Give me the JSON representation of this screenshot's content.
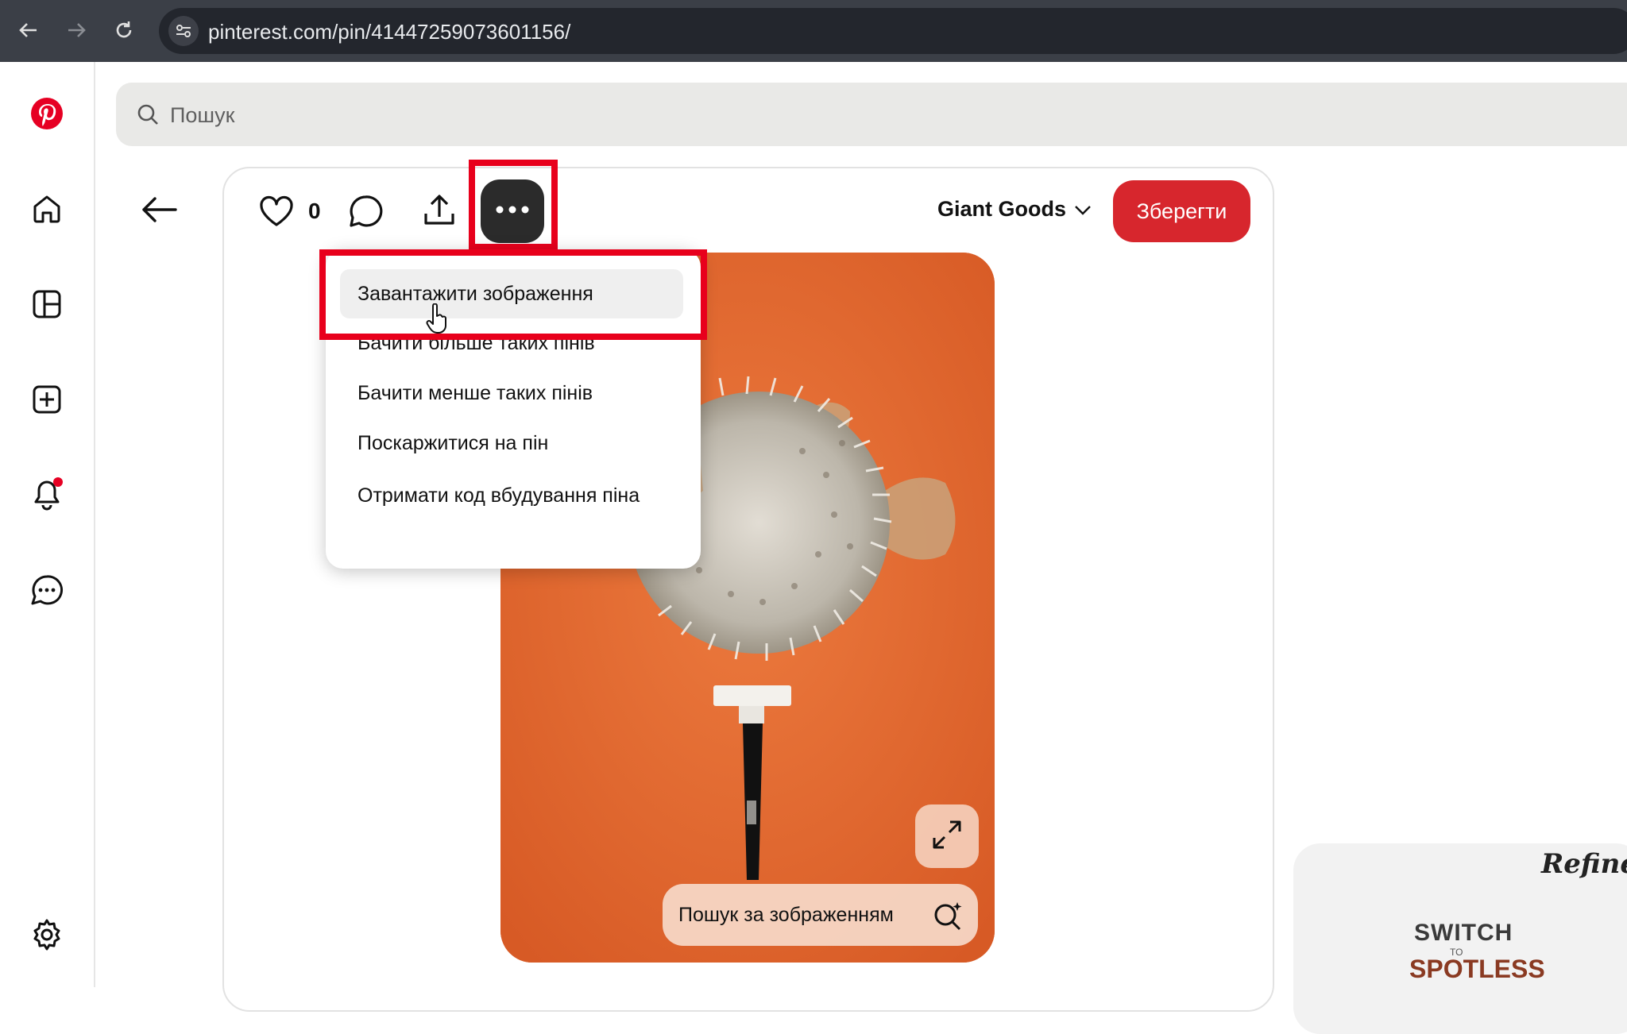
{
  "browser": {
    "url": "pinterest.com/pin/414472590736011​56/"
  },
  "search": {
    "placeholder": "Пошук"
  },
  "pin": {
    "like_count": "0",
    "board_name": "Giant Goods",
    "save_label": "Зберегти",
    "visual_search_label": "Пошук за зображенням"
  },
  "menu": {
    "items": [
      "Завантажити зображення",
      "Бачити більше таких пінів",
      "Бачити менше таких пінів",
      "Поскаржитися на пін",
      "Отримати код вбудування піна"
    ]
  },
  "ad": {
    "brand": "Refine",
    "line1": "SWITCH",
    "line2": "TO",
    "line3": "SPOTLESS"
  },
  "colors": {
    "brand_red": "#e60023",
    "save_button": "#d7262d",
    "highlight": "#e8001c",
    "image_bg": "#e2682f"
  },
  "icons": [
    "back-icon",
    "forward-icon",
    "reload-icon",
    "site-settings-icon",
    "pinterest-logo",
    "home-icon",
    "explore-icon",
    "create-icon",
    "notifications-icon",
    "messages-icon",
    "settings-icon",
    "search-icon",
    "arrow-left-icon",
    "heart-icon",
    "comment-icon",
    "share-icon",
    "more-icon",
    "chevron-down-icon",
    "expand-icon",
    "visual-search-icon",
    "hand-cursor-icon"
  ]
}
